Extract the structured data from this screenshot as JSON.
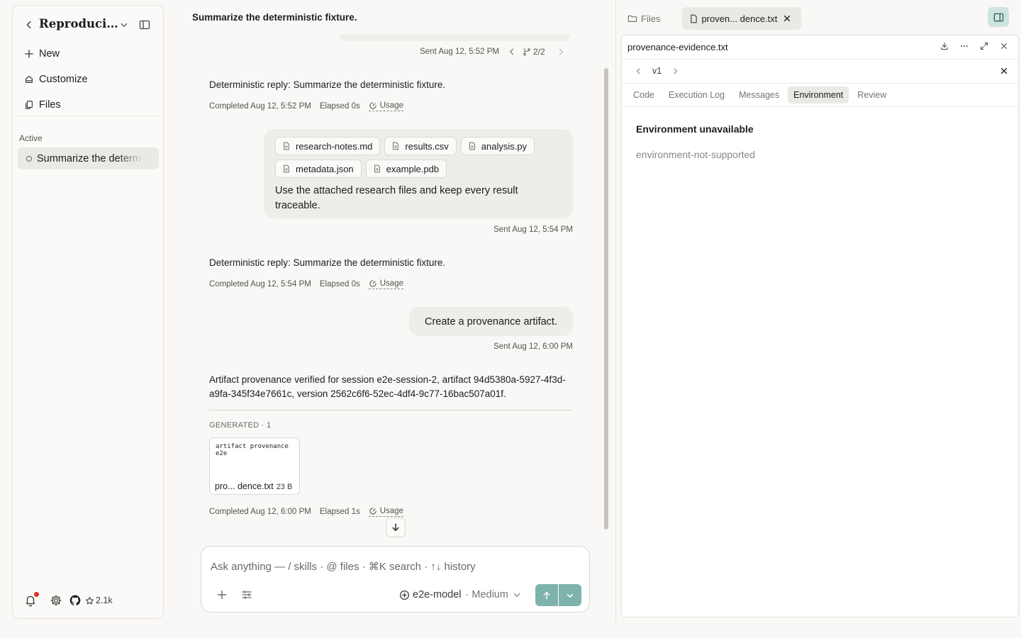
{
  "sidebar": {
    "title": "Reproducibl...",
    "nav": [
      {
        "label": "New",
        "icon": "plus-icon"
      },
      {
        "label": "Customize",
        "icon": "customize-icon"
      },
      {
        "label": "Files",
        "icon": "files-icon"
      }
    ],
    "section_label": "Active",
    "session_label": "Summarize the determ",
    "github_stars": "2.1k"
  },
  "chat": {
    "title": "Summarize the deterministic fixture.",
    "branch": {
      "sent": "Sent Aug 12, 5:52 PM",
      "indicator": "2/2"
    },
    "messages": [
      {
        "role": "assistant",
        "text": "Deterministic reply: Summarize the deterministic fixture.",
        "completed": "Completed Aug 12, 5:52 PM",
        "elapsed": "Elapsed 0s",
        "usage": "Usage"
      },
      {
        "role": "user",
        "attachments": [
          "research-notes.md",
          "results.csv",
          "analysis.py",
          "metadata.json",
          "example.pdb"
        ],
        "text": "Use the attached research files and keep every result traceable.",
        "sent": "Sent Aug 12, 5:54 PM"
      },
      {
        "role": "assistant",
        "text": "Deterministic reply: Summarize the deterministic fixture.",
        "completed": "Completed Aug 12, 5:54 PM",
        "elapsed": "Elapsed 0s",
        "usage": "Usage"
      },
      {
        "role": "user",
        "text": "Create a provenance artifact.",
        "sent": "Sent Aug 12, 6:00 PM"
      },
      {
        "role": "assistant",
        "text": "Artifact provenance verified for session e2e-session-2, artifact 94d5380a-5927-4f3d-a9fa-345f34e7661c, version 2562c6f6-52ec-4df4-9c77-16bac507a01f.",
        "generated_label": "GENERATED · 1",
        "artifact": {
          "preview": "artifact provenance e2e",
          "name": "pro... dence.txt",
          "size": "23 B"
        },
        "completed": "Completed Aug 12, 6:00 PM",
        "elapsed": "Elapsed 1s",
        "usage": "Usage"
      }
    ]
  },
  "composer": {
    "placeholder": "Ask anything — / skills · @ files · ⌘K search · ↑↓ history",
    "model": "e2e-model",
    "effort": "· Medium"
  },
  "right_panel": {
    "tabs": {
      "files": "Files",
      "active": "proven... dence.txt"
    },
    "file_name": "provenance-evidence.txt",
    "version": "v1",
    "subtabs": [
      "Code",
      "Execution Log",
      "Messages",
      "Environment",
      "Review"
    ],
    "active_subtab": "Environment",
    "env_title": "Environment unavailable",
    "env_message": "environment-not-supported"
  },
  "colors": {
    "accent": "#7db3ab",
    "notification": "#d93025"
  }
}
